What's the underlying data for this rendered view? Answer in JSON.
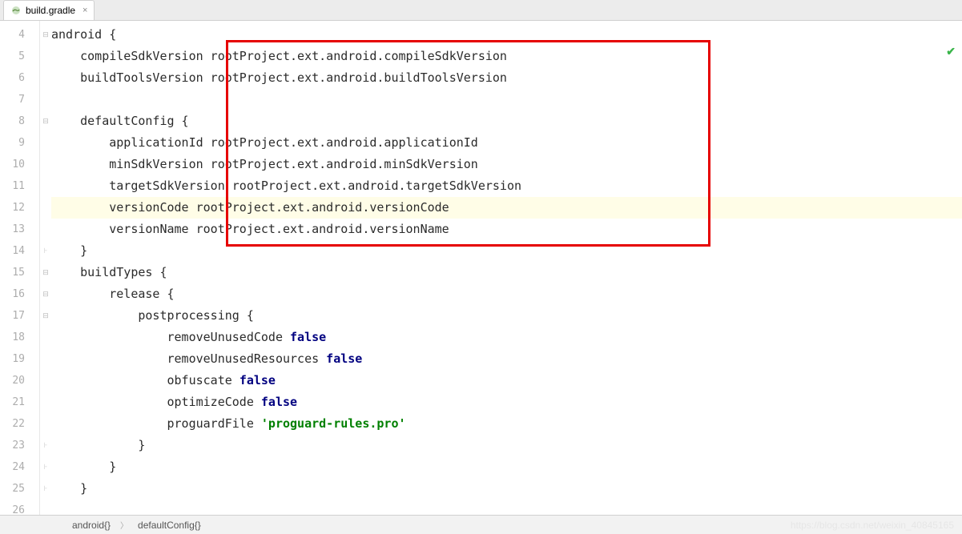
{
  "tab": {
    "filename": "build.gradle"
  },
  "gutter": {
    "start": 4,
    "end": 26
  },
  "code": {
    "l4": "android {",
    "l5": "    compileSdkVersion rootProject.ext.android.compileSdkVersion",
    "l6": "    buildToolsVersion rootProject.ext.android.buildToolsVersion",
    "l7": "",
    "l8": "    defaultConfig {",
    "l9": "        applicationId rootProject.ext.android.applicationId",
    "l10": "        minSdkVersion rootProject.ext.android.minSdkVersion",
    "l11": "        targetSdkVersion rootProject.ext.android.targetSdkVersion",
    "l12": "        versionCode rootProject.ext.android.versionCode",
    "l13": "        versionName rootProject.ext.android.versionName",
    "l14": "    }",
    "l15": "    buildTypes {",
    "l16": "        release {",
    "l17": "            postprocessing {",
    "l18_a": "                removeUnusedCode ",
    "l18_b": "false",
    "l19_a": "                removeUnusedResources ",
    "l19_b": "false",
    "l20_a": "                obfuscate ",
    "l20_b": "false",
    "l21_a": "                optimizeCode ",
    "l21_b": "false",
    "l22_a": "                proguardFile ",
    "l22_b": "'proguard-rules.pro'",
    "l23": "            }",
    "l24": "        }",
    "l25": "    }",
    "l26": ""
  },
  "breadcrumb": {
    "b1": "android{}",
    "b2": "defaultConfig{}"
  },
  "watermark": "https://blog.csdn.net/weixin_40845165"
}
